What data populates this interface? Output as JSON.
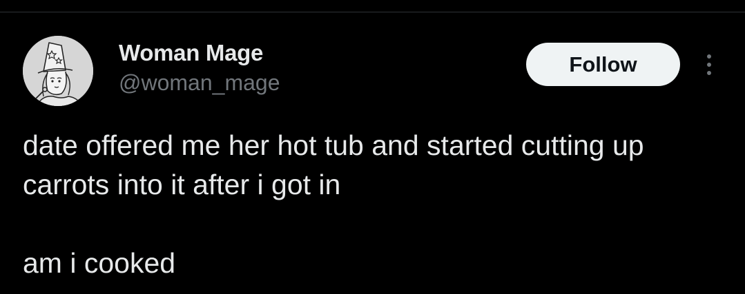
{
  "author": {
    "display_name": "Woman Mage",
    "handle": "@woman_mage",
    "avatar_icon": "witch-sketch-avatar"
  },
  "actions": {
    "follow_label": "Follow",
    "more_icon": "more-vertical-icon"
  },
  "tweet": {
    "paragraphs": [
      "date offered me her hot tub and started cutting up carrots into it after i got in",
      "am i cooked"
    ]
  },
  "colors": {
    "background": "#000000",
    "text_primary": "#e7e9ea",
    "text_secondary": "#71767b",
    "follow_bg": "#eff3f4",
    "follow_text": "#0f1419"
  }
}
